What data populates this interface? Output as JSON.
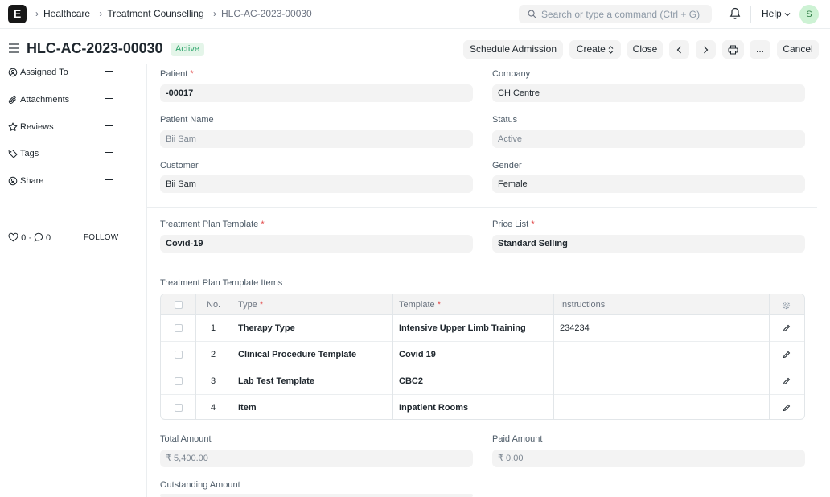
{
  "navbar": {
    "logo_letter": "E",
    "breadcrumbs": [
      "Healthcare",
      "Treatment Counselling",
      "HLC-AC-2023-00030"
    ],
    "search_placeholder": "Search or type a command (Ctrl + G)",
    "help_label": "Help",
    "avatar_initial": "S"
  },
  "page": {
    "title": "HLC-AC-2023-00030",
    "status": "Active",
    "buttons": {
      "schedule_admission": "Schedule Admission",
      "create": "Create",
      "close": "Close",
      "more": "...",
      "cancel": "Cancel"
    }
  },
  "sidebar": {
    "items": [
      {
        "label": "Assigned To",
        "icon": "user-assign-icon"
      },
      {
        "label": "Attachments",
        "icon": "paperclip-icon"
      },
      {
        "label": "Reviews",
        "icon": "star-icon"
      },
      {
        "label": "Tags",
        "icon": "tag-icon"
      },
      {
        "label": "Share",
        "icon": "share-icon"
      }
    ],
    "likes": "0",
    "comments": "0",
    "dot": "·",
    "follow": "FOLLOW"
  },
  "form": {
    "patient": {
      "label": "Patient",
      "value": "-00017"
    },
    "company": {
      "label": "Company",
      "value": "CH Centre"
    },
    "patient_name": {
      "label": "Patient Name",
      "value": "Bii Sam"
    },
    "status": {
      "label": "Status",
      "value": "Active"
    },
    "customer": {
      "label": "Customer",
      "value": "Bii Sam"
    },
    "gender": {
      "label": "Gender",
      "value": "Female"
    },
    "treatment_plan_template": {
      "label": "Treatment Plan Template",
      "value": "Covid-19"
    },
    "price_list": {
      "label": "Price List",
      "value": "Standard Selling"
    },
    "items_label": "Treatment Plan Template Items",
    "total_amount": {
      "label": "Total Amount",
      "value": "₹ 5,400.00"
    },
    "paid_amount": {
      "label": "Paid Amount",
      "value": "₹ 0.00"
    },
    "outstanding_amount": {
      "label": "Outstanding Amount"
    },
    "required_mark": "*"
  },
  "table": {
    "columns": [
      "No.",
      "Type",
      "Template",
      "Instructions"
    ],
    "rows": [
      {
        "no": "1",
        "type": "Therapy Type",
        "template": "Intensive Upper Limb Training",
        "instructions": "234234"
      },
      {
        "no": "2",
        "type": "Clinical Procedure Template",
        "template": "Covid 19",
        "instructions": ""
      },
      {
        "no": "3",
        "type": "Lab Test Template",
        "template": "CBC2",
        "instructions": ""
      },
      {
        "no": "4",
        "type": "Item",
        "template": "Inpatient Rooms",
        "instructions": ""
      }
    ]
  }
}
